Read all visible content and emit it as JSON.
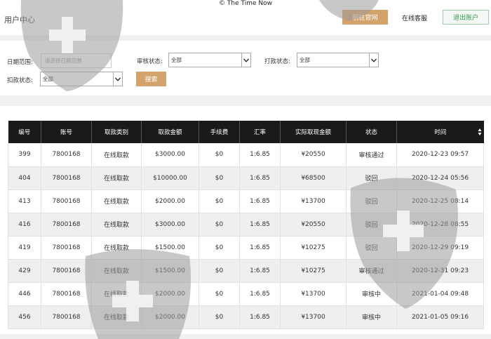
{
  "header": {
    "copyright": "© The Time Now",
    "title": "用户中心",
    "official_button": "前往官网",
    "service_link": "在线客服",
    "logout_button": "退出账户"
  },
  "filters": {
    "date_label": "日期范围:",
    "date_placeholder": "请选择日期范围",
    "audit_label": "审核状态:",
    "audit_value": "全部",
    "payout_label": "打款状态:",
    "payout_value": "全部",
    "deduct_label": "扣款状态:",
    "deduct_value": "全部",
    "search_button": "搜索"
  },
  "table": {
    "columns": [
      "编号",
      "账号",
      "取款类别",
      "取款金额",
      "手续费",
      "汇率",
      "实际取现金额",
      "状态",
      "时间"
    ],
    "rows": [
      [
        "399",
        "7800168",
        "在线取款",
        "$3000.00",
        "$0",
        "1:6.85",
        "¥20550",
        "审核通过",
        "2020-12-23 09:57"
      ],
      [
        "404",
        "7800168",
        "在线取款",
        "$10000.00",
        "$0",
        "1:6.85",
        "¥68500",
        "驳回",
        "2020-12-24 05:56"
      ],
      [
        "413",
        "7800168",
        "在线取款",
        "$2000.00",
        "$0",
        "1:6.85",
        "¥13700",
        "驳回",
        "2020-12-25 08:14"
      ],
      [
        "416",
        "7800168",
        "在线取款",
        "$3000.00",
        "$0",
        "1:6.85",
        "¥20550",
        "驳回",
        "2020-12-28 08:55"
      ],
      [
        "419",
        "7800168",
        "在线取款",
        "$1500.00",
        "$0",
        "1:6.85",
        "¥10275",
        "驳回",
        "2020-12-29 09:19"
      ],
      [
        "429",
        "7800168",
        "在线取款",
        "$1500.00",
        "$0",
        "1:6.85",
        "¥10275",
        "审核通过",
        "2020-12-31 09:23"
      ],
      [
        "446",
        "7800168",
        "在线取款",
        "$2000.00",
        "$0",
        "1:6.85",
        "¥13700",
        "审核中",
        "2021-01-04 09:48"
      ],
      [
        "456",
        "7800168",
        "在线取款",
        "$2000.00",
        "$0",
        "1:6.85",
        "¥13700",
        "审核中",
        "2021-01-05 09:16"
      ]
    ]
  },
  "colors": {
    "accent": "#d4a36b",
    "header_dark": "#1a1a1a",
    "logout_green": "#2e9a4a"
  }
}
